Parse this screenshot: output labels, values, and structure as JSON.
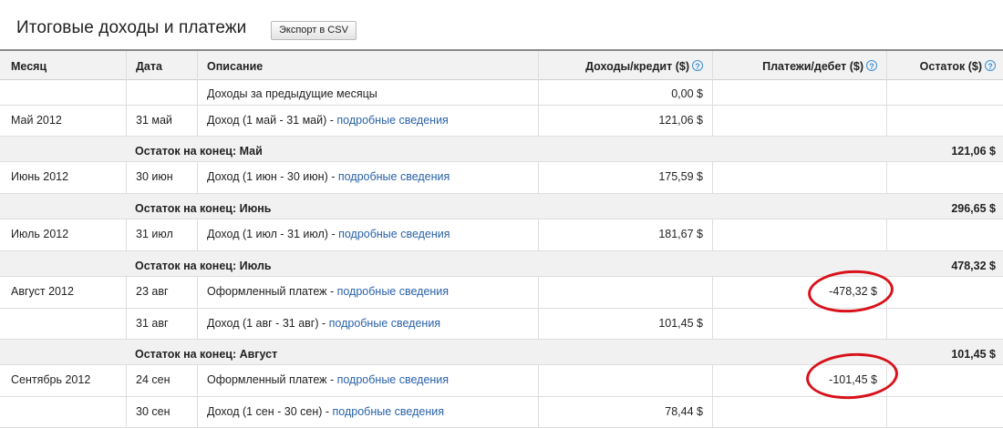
{
  "page": {
    "title": "Итоговые доходы и платежи",
    "export_label": "Экспорт в CSV"
  },
  "table": {
    "columns": {
      "month": "Месяц",
      "date": "Дата",
      "description": "Описание",
      "income": "Доходы/кредит ($)",
      "payments": "Платежи/дебет ($)",
      "balance": "Остаток ($)"
    },
    "help_glyph": "?",
    "details_link": "подробные сведения",
    "link_separator": " - ",
    "rows": [
      {
        "month": "",
        "date": "",
        "desc": "Доходы за предыдущие месяцы",
        "income": "0,00 $",
        "payment": "",
        "has_link": false
      },
      {
        "month": "Май 2012",
        "date": "31 май",
        "desc": "Доход (1 май - 31 май)",
        "income": "121,06 $",
        "payment": "",
        "has_link": true
      },
      {
        "total_label": "Остаток на конец: Май",
        "balance": "121,06 $"
      },
      {
        "month": "Июнь 2012",
        "date": "30 июн",
        "desc": "Доход (1 июн - 30 июн)",
        "income": "175,59 $",
        "payment": "",
        "has_link": true
      },
      {
        "total_label": "Остаток на конец: Июнь",
        "balance": "296,65 $"
      },
      {
        "month": "Июль 2012",
        "date": "31 июл",
        "desc": "Доход (1 июл - 31 июл)",
        "income": "181,67 $",
        "payment": "",
        "has_link": true
      },
      {
        "total_label": "Остаток на конец: Июль",
        "balance": "478,32 $"
      },
      {
        "month": "Август 2012",
        "date": "23 авг",
        "desc": "Оформленный платеж",
        "income": "",
        "payment": "-478,32 $",
        "has_link": true
      },
      {
        "month": "",
        "date": "31 авг",
        "desc": "Доход (1 авг - 31 авг)",
        "income": "101,45 $",
        "payment": "",
        "has_link": true
      },
      {
        "total_label": "Остаток на конец: Август",
        "balance": "101,45 $"
      },
      {
        "month": "Сентябрь 2012",
        "date": "24 сен",
        "desc": "Оформленный платеж",
        "income": "",
        "payment": "-101,45 $",
        "has_link": true
      },
      {
        "month": "",
        "date": "30 сен",
        "desc": "Доход (1 сен - 30 сен)",
        "income": "78,44 $",
        "payment": "",
        "has_link": true
      }
    ]
  },
  "colors": {
    "link": "#2a62a8",
    "annotation": "#d8121b",
    "help_icon": "#3a8fd6"
  }
}
